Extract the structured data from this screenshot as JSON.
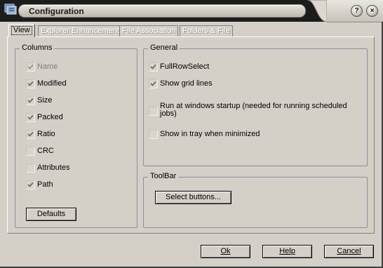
{
  "window": {
    "title": "Configuration",
    "icon": "app-icon"
  },
  "caption_buttons": {
    "help": "?",
    "close": "×"
  },
  "tabs": [
    {
      "label": "View",
      "active": true
    },
    {
      "label": "Explorer Enhancement",
      "active": false
    },
    {
      "label": "File Association",
      "active": false
    },
    {
      "label": "Folders & File",
      "active": false
    }
  ],
  "columns_group": {
    "title": "Columns",
    "items": [
      {
        "label": "Name",
        "checked": true,
        "disabled": true
      },
      {
        "label": "Modified",
        "checked": true,
        "disabled": false
      },
      {
        "label": "Size",
        "checked": true,
        "disabled": false
      },
      {
        "label": "Packed",
        "checked": true,
        "disabled": false
      },
      {
        "label": "Ratio",
        "checked": true,
        "disabled": false
      },
      {
        "label": "CRC",
        "checked": false,
        "disabled": false
      },
      {
        "label": "Attributes",
        "checked": false,
        "disabled": false
      },
      {
        "label": "Path",
        "checked": true,
        "disabled": false
      }
    ],
    "defaults_button": "Defaults"
  },
  "general_group": {
    "title": "General",
    "items": [
      {
        "label": "FullRowSelect",
        "checked": true
      },
      {
        "label": "Show grid lines",
        "checked": true
      },
      {
        "label": "Run at windows startup (needed for running scheduled jobs)",
        "checked": false
      },
      {
        "label": "Show in tray when minimized",
        "checked": false
      }
    ]
  },
  "toolbar_group": {
    "title": "ToolBar",
    "select_button": "Select buttons..."
  },
  "dialog_buttons": {
    "ok": "Ok",
    "help": "Help",
    "cancel": "Cancel"
  },
  "colors": {
    "dialog_bg": "#d4d0c8",
    "titlebar_bg": "#1c1c1c",
    "disabled_text": "#808080"
  }
}
